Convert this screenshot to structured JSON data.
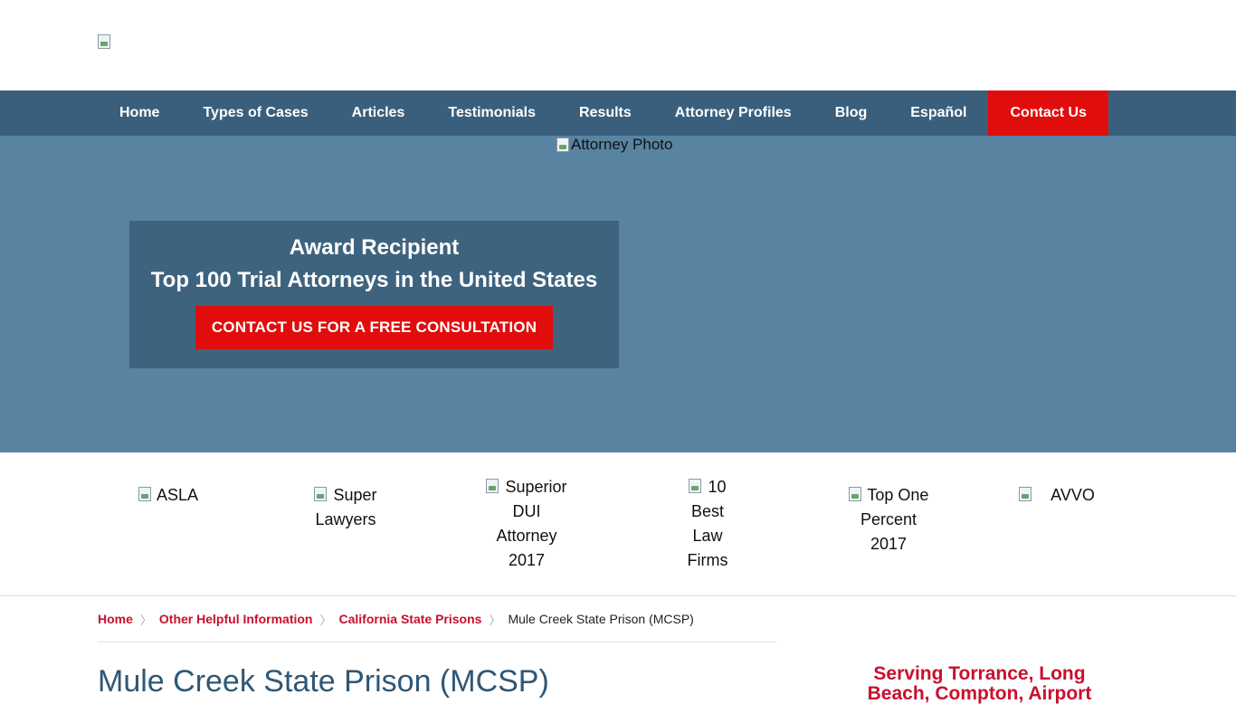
{
  "header": {
    "logo_alt": ""
  },
  "nav": {
    "items": [
      "Home",
      "Types of Cases",
      "Articles",
      "Testimonials",
      "Results",
      "Attorney Profiles",
      "Blog",
      "Español"
    ],
    "contact_label": "Contact Us"
  },
  "hero": {
    "photo_alt": "Attorney Photo",
    "award_line1": "Award Recipient",
    "award_line2": "Top 100 Trial Attorneys in the United States",
    "cta_label": "CONTACT US FOR A FREE CONSULTATION"
  },
  "badges": [
    {
      "label": "ASLA"
    },
    {
      "label": "Super Lawyers"
    },
    {
      "label": "Superior DUI Attorney 2017"
    },
    {
      "label": "10 Best Law Firms"
    },
    {
      "label": "Top One Percent 2017"
    },
    {
      "label": "AVVO"
    }
  ],
  "breadcrumb": {
    "links": [
      "Home",
      "Other Helpful Information",
      "California State Prisons"
    ],
    "current": "Mule Creek State Prison (MCSP)"
  },
  "content": {
    "title": "Mule Creek State Prison (MCSP)"
  },
  "sidebar": {
    "title": "Serving Torrance, Long Beach, Compton, Airport"
  },
  "colors": {
    "nav_bg": "#3a5f7d",
    "hero_bg": "#5883a1",
    "award_bg": "#3e637f",
    "accent_red": "#e10d0d",
    "link_red": "#c8102e"
  }
}
